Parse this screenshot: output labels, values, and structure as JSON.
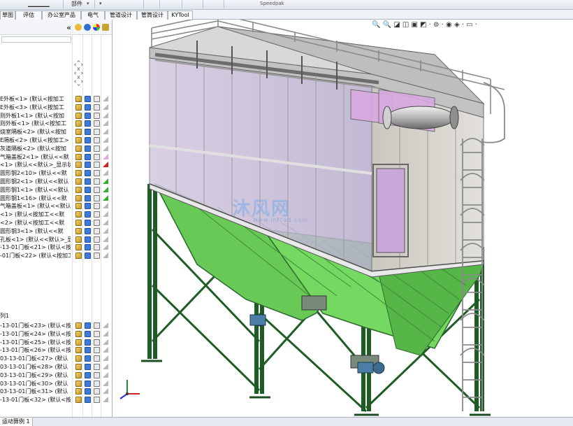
{
  "ribbon": {
    "part_label": "部件",
    "dropdown_icon": "chevron-down-icon",
    "toolbar_tail_label": "Speedpak"
  },
  "tabs": [
    "草图",
    "评估",
    "办公室产品",
    "电气",
    "管道设计",
    "管筒设计",
    "KYTool"
  ],
  "tree": {
    "collapse_glyph": "«",
    "rows": [
      "E外板<1> (默认<按加工",
      "E外板<3> (默认<按加工",
      "则外板1<1> (默认<按加",
      "则外板<1> (默认<按加工",
      "烧室隔板<2> (默认<按加",
      "E隔板<2> (默认<按加工>",
      "灰道隔板<2> (默认<按加",
      "气箱盖板2<1> (默认<<默",
      "<1> (默认<<默认>_显示状",
      "圆形钢2<10> (默认<<默",
      "圆形钢2<1> (默认<<默认",
      "圆形钢1<1> (默认<<默认",
      "圆形钢1<16> (默认<<默",
      "气箱盖板<1> (默认<<默认",
      "<1> (默认<按加工<<默",
      "<2> (默认<按加工<<默",
      "圆形钢3<1> (默认<<默",
      "孔板<1> (默认<<默认>_显",
      "-13-01门板<21> (默认<按",
      "-01门板<22> (默认<按加工"
    ],
    "lower_header": "列1",
    "lower_rows": [
      "-13-01门板<23> (默认<按",
      "-13-01门板<24> (默认<按",
      "-13-01门板<25> (默认<按",
      "-13-01门板<26> (默认<按",
      "03-13-01门板<27> (默认",
      "03-13-01门板<28> (默认",
      "03-13-01门板<29> (默认",
      "03-13-01门板<30> (默认",
      "03-13-01门板<31> (默认",
      "-13-01门板<32> (默认<按"
    ]
  },
  "viewport": {
    "watermark": "沐风网",
    "watermark_sub": "www.mfcad.com",
    "view_tools": "🔍 🔍 ◪ ◫ ▣ ◩ · ⊚ · ◉ ◈ · ▭ ·"
  },
  "status": {
    "tab_label": "运动算例 1"
  },
  "colors": {
    "frame_green": "#2f7d34",
    "hopper_green": "#6ecf59",
    "panel_gray": "#d8d6cf",
    "glass_violet": "#b69cd4",
    "door_pink": "#c9a7d9",
    "rail_gray": "#8a8a8a"
  }
}
